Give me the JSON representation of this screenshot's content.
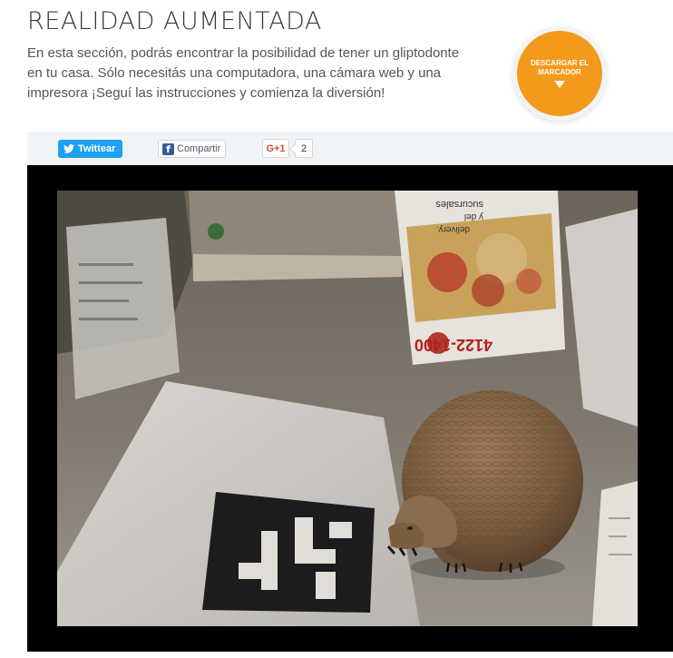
{
  "page": {
    "title": "REALIDAD AUMENTADA",
    "intro": "En esta sección, podrás encontrar la posibilidad de tener un gliptodonte en tu casa. Sólo necesitás una computadora, una cámara web y una impresora ¡Seguí las instrucciones y comienza la diversión!"
  },
  "download": {
    "label": "DESCARGAR EL MARCADOR",
    "icon": "arrow-down-icon",
    "color": "#f39a1c"
  },
  "share": {
    "twitter_label": "Twittear",
    "facebook_label": "Compartir",
    "gplus_label": "G+1",
    "gplus_count": "2"
  },
  "scene": {
    "flyer_phone": "4122-1400",
    "flyer_line1": "sucursales",
    "flyer_line2": "y del",
    "flyer_line3": "delivery.",
    "colors": {
      "frame": "#000000",
      "twitter": "#1da1f2",
      "facebook": "#3b5998",
      "gplus": "#dd4b39"
    }
  }
}
